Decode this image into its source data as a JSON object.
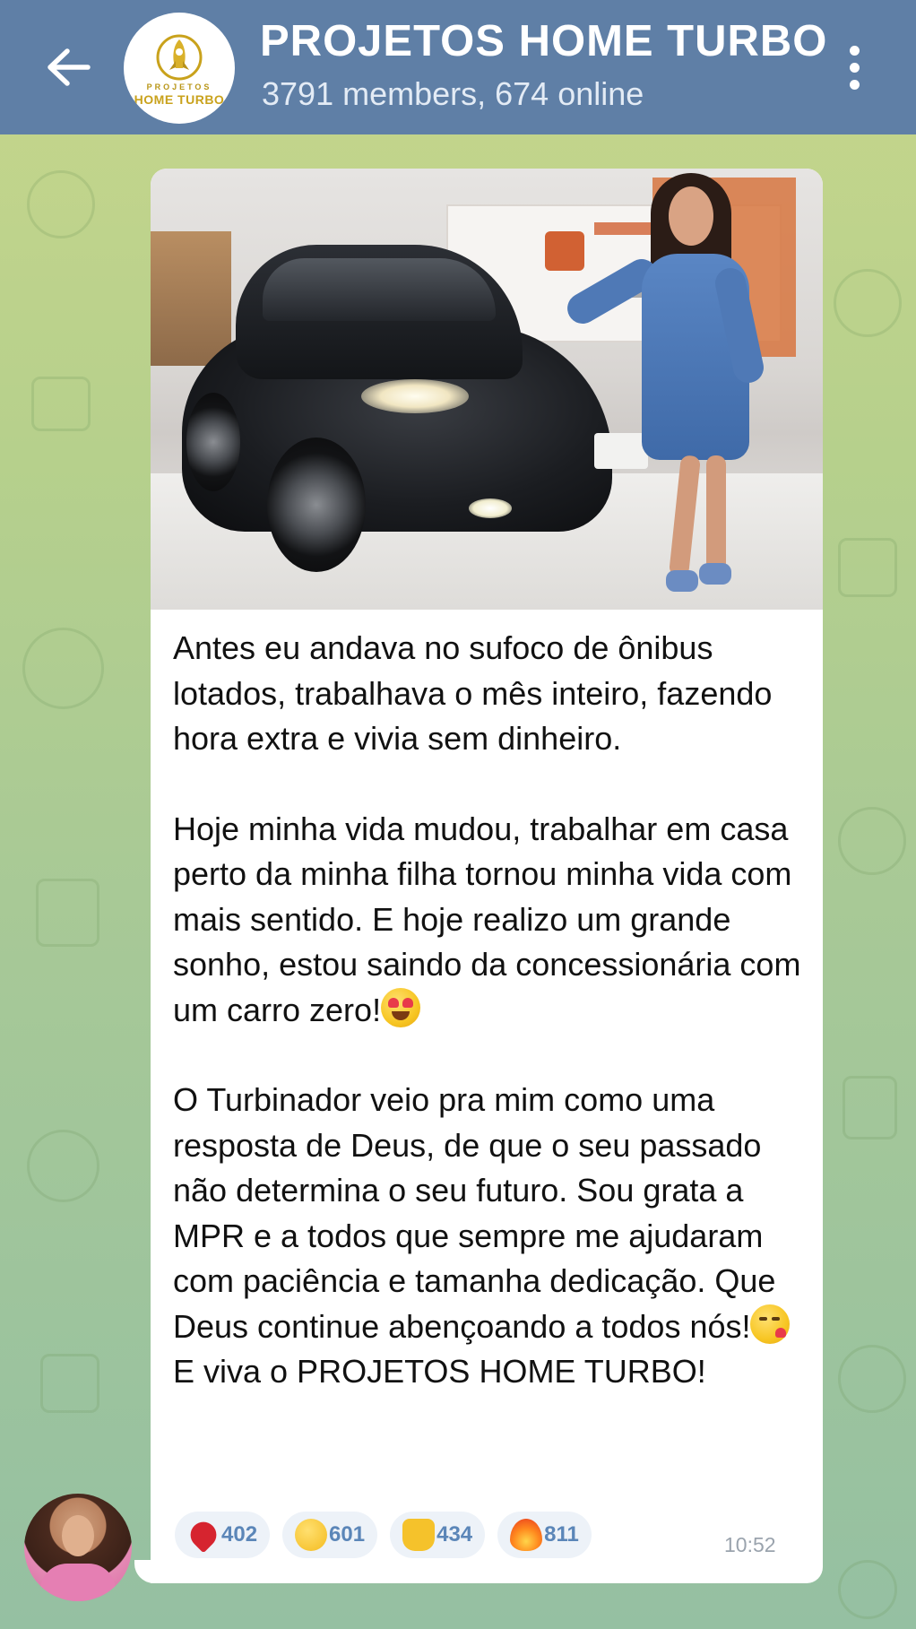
{
  "header": {
    "title": "PROJETOS HOME TURBO",
    "status": "3791 members, 674 online",
    "logo_line1": "PROJETOS",
    "logo_line2": "HOME TURBO"
  },
  "message": {
    "paragraph1": "Antes eu andava no sufoco de ônibus lotados, trabalhava o mês inteiro, fazendo hora extra e vivia sem dinheiro.",
    "paragraph2": "Hoje minha vida mudou, trabalhar em casa perto da minha filha tornou minha vida com mais sentido. E hoje realizo um grande sonho, estou saindo da concessionária com um carro zero!",
    "paragraph3": "O Turbinador veio pra mim como uma resposta de Deus, de que o seu passado não determina o seu futuro. Sou grata a MPR e a todos que sempre me ajudaram com paciência e tamanha dedicação. Que Deus continue abençoando a todos nós!",
    "paragraph4": "E viva o PROJETOS HOME TURBO!",
    "time": "10:52",
    "reactions": [
      {
        "icon": "heart-emoji",
        "count": "402"
      },
      {
        "icon": "screaming-face-emoji",
        "count": "601"
      },
      {
        "icon": "thumbs-up-emoji",
        "count": "434"
      },
      {
        "icon": "fire-emoji",
        "count": "811"
      }
    ]
  },
  "colors": {
    "header_bg": "#5f7fa6",
    "bubble_bg": "#ffffff",
    "reaction_bg": "#edf2f8",
    "reaction_text": "#5b86b8",
    "timestamp": "#9aa3ad"
  }
}
